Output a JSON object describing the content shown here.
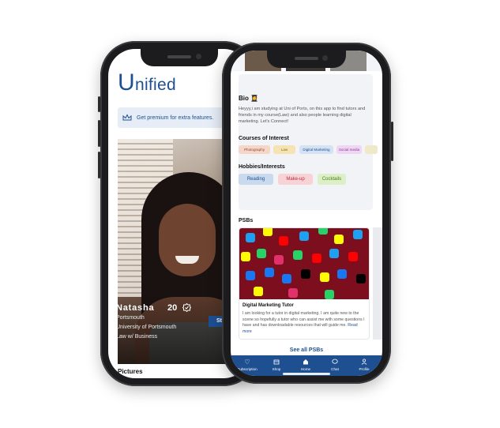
{
  "brand": {
    "logo_letter": "U",
    "logo_rest": "nified",
    "color": "#1d4f91"
  },
  "profile_screen": {
    "premium_text": "Get premium for extra features.",
    "name": "Natasha",
    "age": "20",
    "city": "Portsmouth",
    "university": "University of Portsmouth",
    "course": "Law w/ Business",
    "status_badge": "Stud",
    "pictures_heading": "Pictures"
  },
  "detail_screen": {
    "bio": {
      "heading": "Bio",
      "emoji": "👩‍🎓",
      "text": "Heyyy,i am studying at Uni of Ports, on this app to find tutors and friends in my course(Law) and also people learning digital marketing. Let's Connect!"
    },
    "courses": {
      "heading": "Courses of Interest",
      "items": [
        {
          "label": "Photography",
          "bg": "#f6d6c8",
          "fg": "#8a4a30"
        },
        {
          "label": "Law",
          "bg": "#f6e3b4",
          "fg": "#8a6a10"
        },
        {
          "label": "Digital Marketing",
          "bg": "#d4e2f4",
          "fg": "#1d4f91"
        },
        {
          "label": "Social media",
          "bg": "#efd6f2",
          "fg": "#8a3a96"
        },
        {
          "label": "",
          "bg": "#f0e9c9",
          "fg": "#8a7a30"
        }
      ]
    },
    "hobbies": {
      "heading": "Hobbies/Interests",
      "items": [
        {
          "label": "Reading",
          "bg": "#c9d9ee",
          "fg": "#1d4f91"
        },
        {
          "label": "Make-up",
          "bg": "#f7d3d6",
          "fg": "#b0303c"
        },
        {
          "label": "Cocktails",
          "bg": "#dcefc6",
          "fg": "#4a7a20"
        }
      ]
    },
    "psbs": {
      "heading": "PSBs",
      "card": {
        "title": "Digital Marketing Tutor",
        "description": "I am looking for a tutor in digital marketing. I am quite new to the scene so hopefully a tutor who can assist me with some questions I have and has downloadable resources that will guide me.",
        "more": "Read more"
      },
      "see_all": "See all PSBs"
    },
    "nav": [
      {
        "label": "Subscription",
        "icon": "heart-icon"
      },
      {
        "label": "Shop",
        "icon": "shop-icon"
      },
      {
        "label": "Home",
        "icon": "home-icon"
      },
      {
        "label": "Chat",
        "icon": "chat-icon"
      },
      {
        "label": "Profile",
        "icon": "profile-icon"
      }
    ]
  }
}
